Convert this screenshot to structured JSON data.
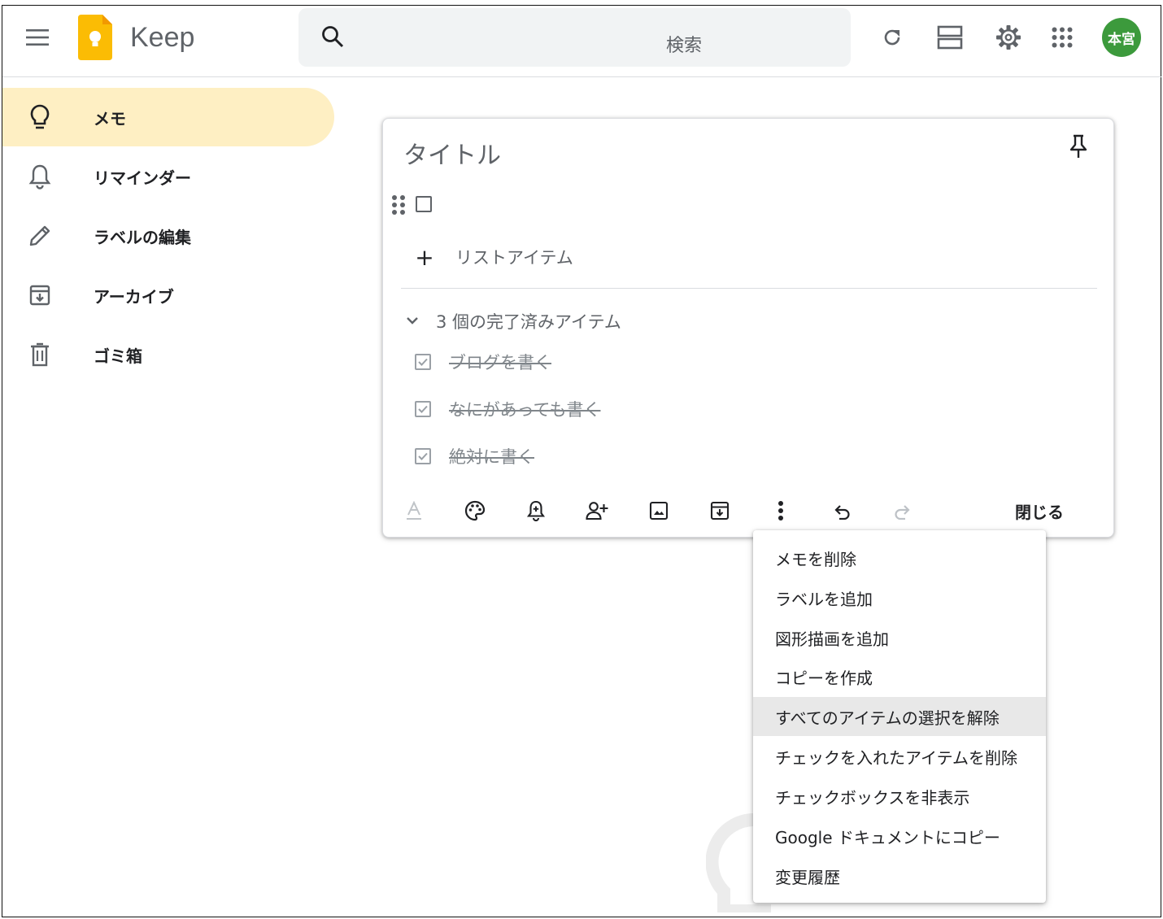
{
  "header": {
    "app_name": "Keep",
    "search_placeholder": "検索",
    "avatar_text": "本宮",
    "icons": [
      "menu-icon",
      "keep-logo",
      "search-icon",
      "refresh-icon",
      "list-view-icon",
      "settings-icon",
      "apps-icon"
    ]
  },
  "sidebar": {
    "items": [
      {
        "label": "メモ",
        "icon": "lightbulb-icon",
        "active": true
      },
      {
        "label": "リマインダー",
        "icon": "bell-icon"
      },
      {
        "label": "ラベルの編集",
        "icon": "pencil-icon"
      },
      {
        "label": "アーカイブ",
        "icon": "archive-icon"
      },
      {
        "label": "ゴミ箱",
        "icon": "trash-icon"
      }
    ]
  },
  "note": {
    "title": "タイトル",
    "add_item_label": "リストアイテム",
    "completed_header": "3 個の完了済みアイテム",
    "completed_items": [
      "ブログを書く",
      "なにがあっても書く",
      "絶対に書く"
    ],
    "close_label": "閉じる",
    "toolbar_icons": [
      "text-format-icon",
      "palette-icon",
      "reminder-icon",
      "collaborator-icon",
      "image-icon",
      "archive-icon",
      "more-icon",
      "undo-icon",
      "redo-icon"
    ]
  },
  "menu": {
    "items": [
      "メモを削除",
      "ラベルを追加",
      "図形描画を追加",
      "コピーを作成",
      "すべてのアイテムの選択を解除",
      "チェックを入れたアイテムを削除",
      "チェックボックスを非表示",
      "Google ドキュメントにコピー",
      "変更履歴"
    ],
    "highlighted_index": 4
  },
  "colors": {
    "active_nav": "#feefc3",
    "logo_yellow": "#fbbc04",
    "avatar_green": "#3c9a3c"
  }
}
